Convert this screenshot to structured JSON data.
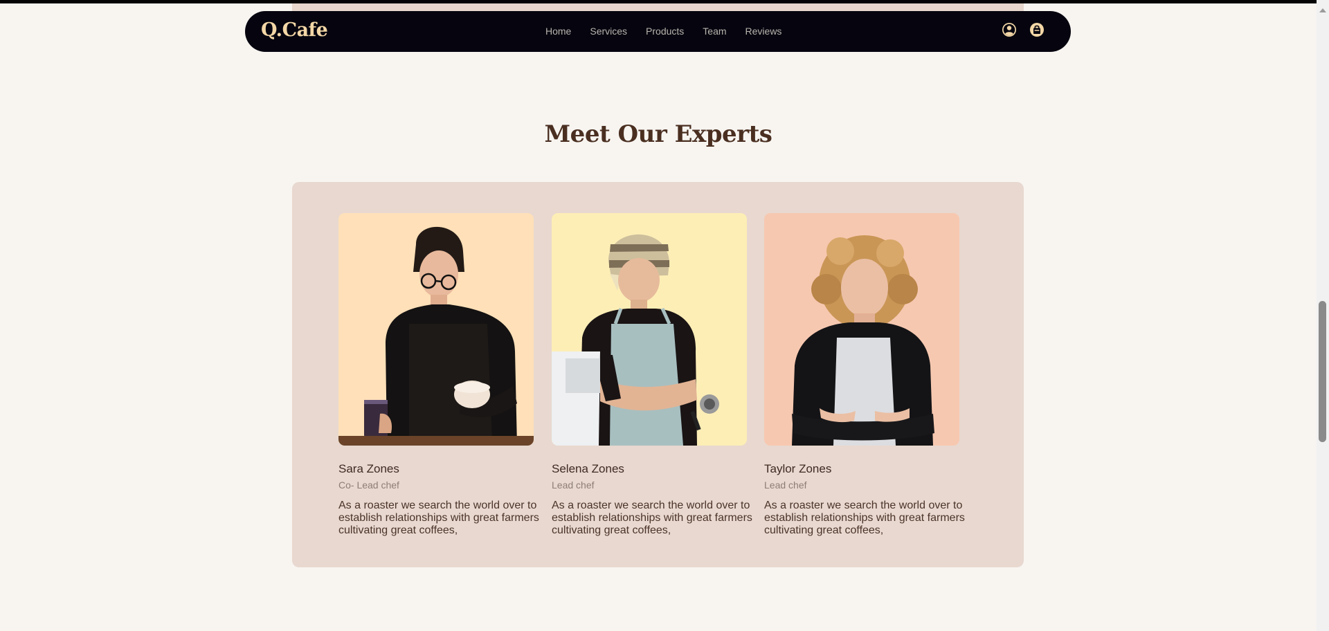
{
  "brand": {
    "logo": "Q.Cafe"
  },
  "nav": {
    "links": [
      "Home",
      "Services",
      "Products",
      "Team",
      "Reviews"
    ],
    "icons": [
      "user-icon",
      "shopping-bag-icon"
    ]
  },
  "team": {
    "title": "Meet Our Experts",
    "members": [
      {
        "name": "Sara Zones",
        "role": "Co- Lead chef",
        "description": "As a roaster we search the world over to establish relationships with great farmers cultivating great coffees,",
        "photo_bg": "#ffe0b8"
      },
      {
        "name": "Selena Zones",
        "role": "Lead chef",
        "description": "As a roaster we search the world over to establish relationships with great farmers cultivating great coffees,",
        "photo_bg": "#fdeeb6"
      },
      {
        "name": "Taylor Zones",
        "role": "Lead chef",
        "description": "As a roaster we search the world over to establish relationships with great farmers cultivating great coffees,",
        "photo_bg": "#f7c8b0"
      }
    ]
  },
  "colors": {
    "page_bg": "#f8f5f1",
    "nav_bg": "#06050f",
    "logo": "#f3d7a6",
    "title": "#4a2f21",
    "panel": "#e8d8cf"
  }
}
